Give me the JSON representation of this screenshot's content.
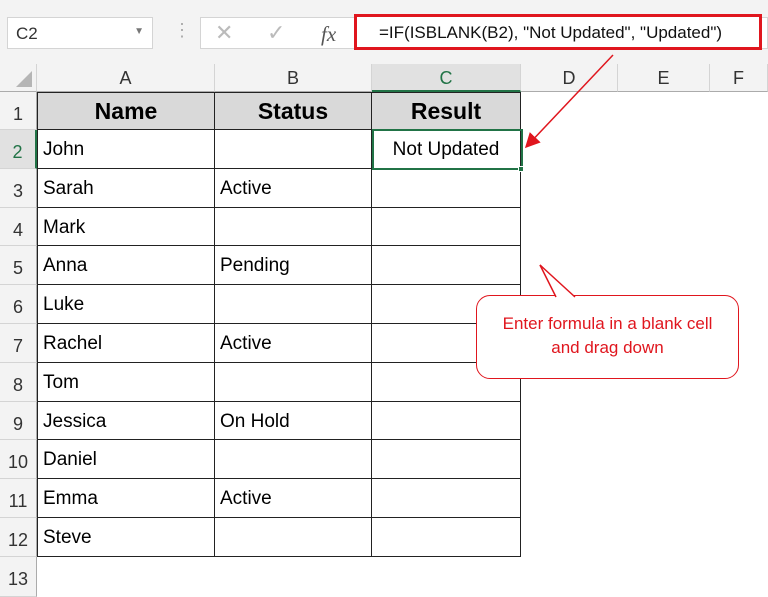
{
  "name_box": "C2",
  "formula": "=IF(ISBLANK(B2), \"Not Updated\", \"Updated\")",
  "columns": [
    "A",
    "B",
    "C",
    "D",
    "E",
    "F"
  ],
  "rows": [
    "1",
    "2",
    "3",
    "4",
    "5",
    "6",
    "7",
    "8",
    "9",
    "10",
    "11",
    "12",
    "13"
  ],
  "headers": [
    "Name",
    "Status",
    "Result"
  ],
  "data": [
    [
      "John",
      "",
      "Not Updated"
    ],
    [
      "Sarah",
      "Active",
      ""
    ],
    [
      "Mark",
      "",
      ""
    ],
    [
      "Anna",
      "Pending",
      ""
    ],
    [
      "Luke",
      "",
      ""
    ],
    [
      "Rachel",
      "Active",
      ""
    ],
    [
      "Tom",
      "",
      ""
    ],
    [
      "Jessica",
      "On Hold",
      ""
    ],
    [
      "Daniel",
      "",
      ""
    ],
    [
      "Emma",
      "Active",
      ""
    ],
    [
      "Steve",
      "",
      ""
    ]
  ],
  "callout": "Enter formula in a blank cell and drag down",
  "accent": "#217346",
  "annotation_color": "#e0161e"
}
